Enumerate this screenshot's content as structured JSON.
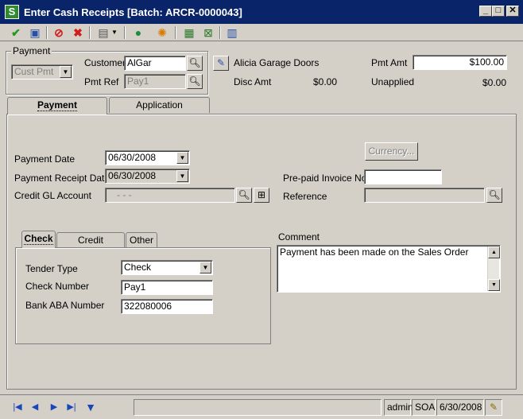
{
  "window": {
    "title": "Enter Cash Receipts [Batch: ARCR-0000043]",
    "app_icon_letter": "S",
    "controls": [
      "_",
      "□",
      "✕"
    ]
  },
  "toolbar": {
    "icons": [
      "check-icon",
      "save-icon",
      "stop-icon",
      "delete-icon",
      "document-icon",
      "dropdown-arrow-icon",
      "help-icon",
      "color-wheel-icon",
      "spreadsheet-icon",
      "spreadsheet-x-icon",
      "list-window-icon"
    ]
  },
  "payment_group": {
    "label": "Payment",
    "type_value": "Cust Pmt",
    "customer_label": "Customer",
    "customer_value": "AlGar",
    "pmtref_label": "Pmt Ref",
    "pmtref_value": "Pay1"
  },
  "header_info": {
    "customer_name": "Alicia Garage Doors",
    "disc_amt_label": "Disc Amt",
    "disc_amt_value": "$0.00",
    "pmt_amt_label": "Pmt Amt",
    "pmt_amt_value": "$100.00",
    "unapplied_label": "Unapplied",
    "unapplied_value": "$0.00"
  },
  "tabs": [
    {
      "label": "Payment",
      "active": true
    },
    {
      "label": "Application",
      "active": false
    }
  ],
  "payment_tab": {
    "currency_button": "Currency...",
    "payment_date_label": "Payment Date",
    "payment_date_value": "06/30/2008",
    "receipt_date_label": "Payment Receipt Date",
    "receipt_date_value": "06/30/2008",
    "gl_account_label": "Credit GL Account",
    "gl_account_value": "- - -",
    "prepaid_label": "Pre-paid Invoice No",
    "prepaid_value": "",
    "reference_label": "Reference",
    "reference_value": ""
  },
  "subtabs": [
    {
      "label": "Check",
      "active": true
    },
    {
      "label": "Credit Card/EFT",
      "active": false
    },
    {
      "label": "Other",
      "active": false
    }
  ],
  "check": {
    "tender_label": "Tender Type",
    "tender_value": "Check",
    "number_label": "Check Number",
    "number_value": "Pay1",
    "aba_label": "Bank ABA Number",
    "aba_value": "322080006"
  },
  "comment": {
    "label": "Comment",
    "value": "Payment has been made on the Sales Order"
  },
  "statusbar": {
    "user": "admin",
    "company": "SOA",
    "date": "6/30/2008"
  }
}
